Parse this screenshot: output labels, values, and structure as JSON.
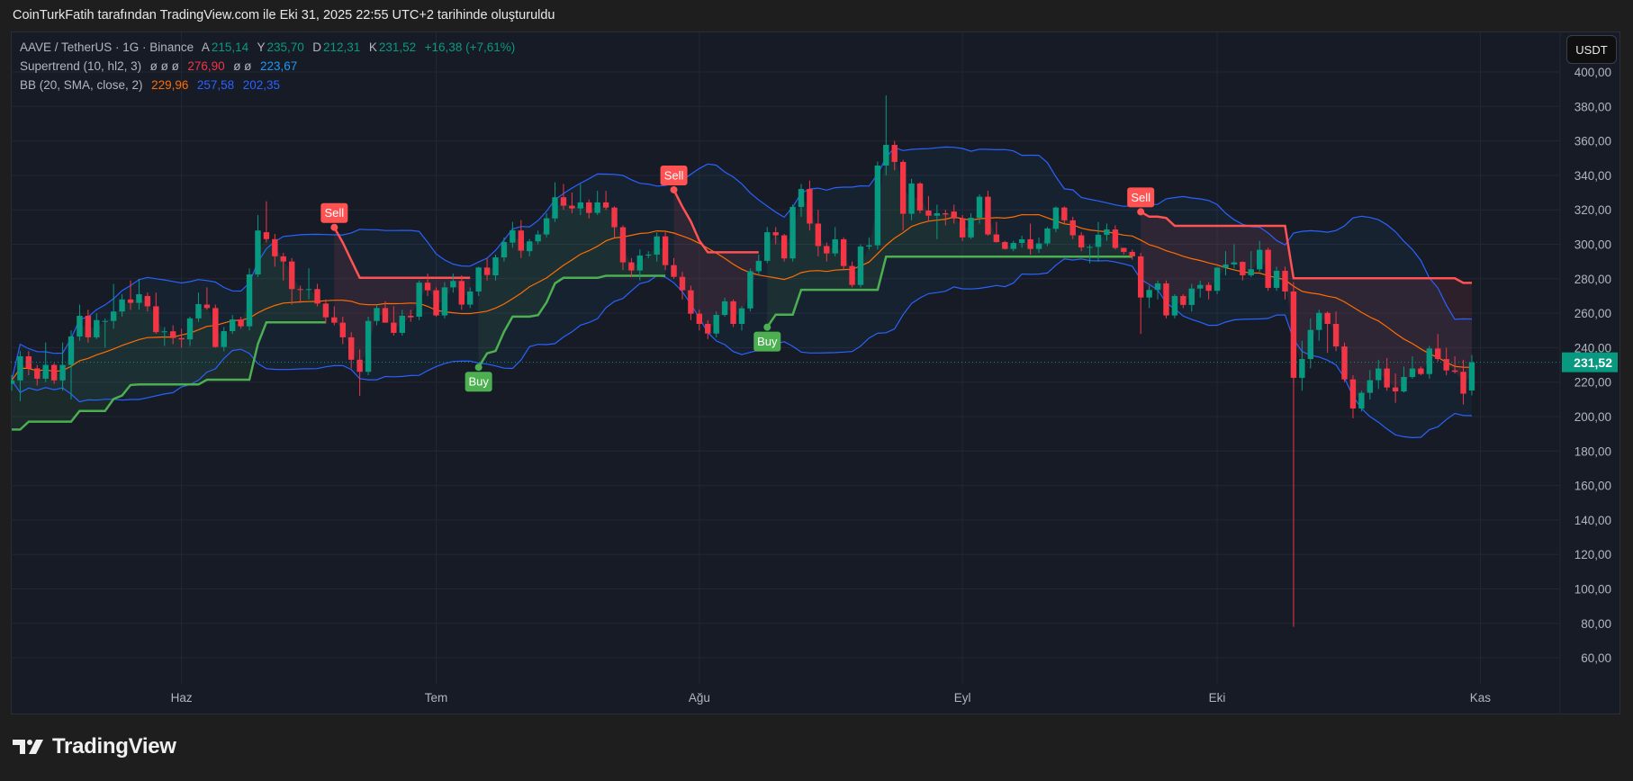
{
  "caption": "CoinTurkFatih tarafından TradingView.com ile Eki 31, 2025 22:55 UTC+2 tarihinde oluşturuldu",
  "legend": {
    "symbol": "AAVE / TetherUS · 1G · Binance",
    "o_label": "A",
    "o_value": "215,14",
    "h_label": "Y",
    "h_value": "235,70",
    "l_label": "D",
    "l_value": "212,31",
    "c_label": "K",
    "c_value": "231,52",
    "change": "+16,38 (+7,61%)",
    "supertrend_name": "Supertrend (10, hl2, 3)",
    "supertrend_na1": "ø  ø  ø",
    "supertrend_down": "276,90",
    "supertrend_na2": "ø  ø",
    "supertrend_body": "223,67",
    "bb_name": "BB (20, SMA, close, 2)",
    "bb_basis": "229,96",
    "bb_upper": "257,58",
    "bb_lower": "202,35"
  },
  "currency_button": "USDT",
  "last_price_label": "231,52",
  "brand": "TradingView",
  "colors": {
    "up": "#089981",
    "down": "#f23645",
    "st_up": "#4caf50",
    "st_down": "#ff5252",
    "bb_basis": "#ff6d00",
    "bb_band": "#2962ff"
  },
  "chart_data": {
    "type": "candlestick",
    "title": "AAVE / TetherUS · 1G · Binance",
    "ylabel": "USDT",
    "ylim": [
      60,
      400
    ],
    "y_ticks": [
      60,
      80,
      100,
      120,
      140,
      160,
      180,
      200,
      220,
      240,
      260,
      280,
      300,
      320,
      340,
      360,
      380,
      400
    ],
    "x_ticks": [
      {
        "label": "Haz",
        "index": 20
      },
      {
        "label": "Tem",
        "index": 50
      },
      {
        "label": "Ağu",
        "index": 81
      },
      {
        "label": "Eyl",
        "index": 112
      },
      {
        "label": "Eki",
        "index": 142
      },
      {
        "label": "Kas",
        "index": 173
      }
    ],
    "grid": true,
    "last_price": 231.52,
    "indicators": {
      "supertrend": {
        "atr_length": 10,
        "source": "hl2",
        "factor": 3,
        "buy_label": "Buy",
        "sell_label": "Sell"
      },
      "bollinger": {
        "length": 20,
        "type": "SMA",
        "source": "close",
        "mult": 2
      }
    },
    "ohlc": [
      [
        219,
        224,
        215,
        221
      ],
      [
        221,
        238,
        209,
        235
      ],
      [
        235,
        238,
        224,
        228
      ],
      [
        228,
        230,
        218,
        222
      ],
      [
        222,
        243,
        220,
        230
      ],
      [
        230,
        231,
        219,
        221
      ],
      [
        221,
        243,
        215,
        230
      ],
      [
        230,
        250,
        210,
        246.5
      ],
      [
        246.5,
        265,
        244,
        258.5
      ],
      [
        258.5,
        262,
        243,
        246
      ],
      [
        246,
        260,
        245,
        256
      ],
      [
        255,
        257,
        240,
        255.5
      ],
      [
        255.5,
        277,
        251,
        261
      ],
      [
        261,
        271,
        258,
        268
      ],
      [
        268,
        279,
        262,
        266
      ],
      [
        266,
        280,
        262,
        271
      ],
      [
        270,
        272,
        261,
        264
      ],
      [
        264,
        272,
        248,
        249
      ],
      [
        249.5,
        252,
        241,
        249.5
      ],
      [
        249.5,
        253,
        242,
        245.6
      ],
      [
        245.6,
        251,
        240,
        244.8
      ],
      [
        244.8,
        258,
        241,
        257
      ],
      [
        257,
        272,
        255,
        265.3
      ],
      [
        265,
        275,
        262,
        263
      ],
      [
        263,
        265,
        240,
        240.4
      ],
      [
        240.4,
        252,
        238,
        249.6
      ],
      [
        249.6,
        259,
        248,
        256.4
      ],
      [
        256.4,
        258,
        251,
        252.4
      ],
      [
        252.4,
        286,
        250,
        282.5
      ],
      [
        282.5,
        317,
        281,
        308
      ],
      [
        307,
        325,
        301,
        303
      ],
      [
        303,
        306,
        287,
        293
      ],
      [
        293,
        295,
        279,
        290
      ],
      [
        290,
        292,
        265,
        274
      ],
      [
        274,
        276,
        266,
        273.5
      ],
      [
        273.5,
        286,
        268,
        274
      ],
      [
        274,
        277,
        264,
        265.6
      ],
      [
        265.6,
        268,
        254,
        257.6
      ],
      [
        257.6,
        264,
        253,
        254.5
      ],
      [
        254.5,
        258,
        242,
        246
      ],
      [
        246,
        249,
        228,
        233
      ],
      [
        233,
        239,
        212,
        226
      ],
      [
        226,
        258,
        224,
        255.5
      ],
      [
        255.5,
        265,
        253,
        263
      ],
      [
        263,
        267,
        255,
        254.5
      ],
      [
        254.5,
        264,
        247,
        248.6
      ],
      [
        248.6,
        262,
        247,
        258.5
      ],
      [
        258.5,
        262,
        255,
        257.6
      ],
      [
        258,
        279,
        256,
        277.7
      ],
      [
        277.7,
        283,
        270,
        273.3
      ],
      [
        273.3,
        275,
        258,
        258.7
      ],
      [
        258.7,
        278,
        257,
        275
      ],
      [
        275,
        283,
        272,
        278.7
      ],
      [
        278.7,
        282,
        262,
        265
      ],
      [
        265,
        275,
        263,
        272.6
      ],
      [
        272.6,
        287,
        270,
        286.5
      ],
      [
        286.5,
        292,
        279,
        282.2
      ],
      [
        282,
        294,
        279,
        292.4
      ],
      [
        292.4,
        304,
        290,
        301.3
      ],
      [
        301,
        313,
        298,
        308.1
      ],
      [
        308,
        314,
        292,
        296.3
      ],
      [
        296,
        303,
        293,
        301.7
      ],
      [
        301.7,
        308,
        300,
        305.7
      ],
      [
        305.7,
        318,
        304,
        315.1
      ],
      [
        315,
        336,
        313,
        327.3
      ],
      [
        327.3,
        335,
        320,
        322.4
      ],
      [
        322.4,
        330,
        318,
        320.8
      ],
      [
        320.8,
        335,
        317,
        324.3
      ],
      [
        324.3,
        326,
        315,
        318.2
      ],
      [
        318.2,
        331,
        317,
        324.3
      ],
      [
        324.3,
        331,
        320,
        321.3
      ],
      [
        321.3,
        322,
        304,
        309.9
      ],
      [
        309.9,
        311,
        285,
        289.5
      ],
      [
        289.5,
        292,
        281,
        284.8
      ],
      [
        284.8,
        297,
        279,
        293.5
      ],
      [
        293.5,
        296,
        292,
        294
      ],
      [
        294,
        307,
        290,
        304.6
      ],
      [
        304.6,
        307,
        285,
        287.9
      ],
      [
        287.9,
        292,
        280,
        281.1
      ],
      [
        281.1,
        284,
        268,
        273.3
      ],
      [
        273.3,
        276,
        256,
        259.7
      ],
      [
        259.7,
        262,
        250,
        253.8
      ],
      [
        253.8,
        256,
        245,
        248.2
      ],
      [
        248.2,
        261,
        246,
        259
      ],
      [
        259,
        269,
        258,
        266.9
      ],
      [
        266.9,
        268,
        252,
        253.8
      ],
      [
        253.8,
        264,
        250,
        262.8
      ],
      [
        262.8,
        286,
        261,
        284.4
      ],
      [
        284.4,
        294,
        282,
        290.4
      ],
      [
        290.4,
        310,
        289,
        307
      ],
      [
        307,
        310,
        300,
        305.2
      ],
      [
        305.2,
        306,
        290,
        291.8
      ],
      [
        291.8,
        323,
        290,
        321.7
      ],
      [
        321.7,
        335,
        316,
        332.1
      ],
      [
        332.1,
        337,
        308,
        312
      ],
      [
        312,
        320,
        293,
        299
      ],
      [
        299,
        301,
        290,
        294.7
      ],
      [
        294.7,
        310,
        293,
        302.9
      ],
      [
        302.9,
        304,
        285,
        287.4
      ],
      [
        287.4,
        290,
        275,
        276.4
      ],
      [
        276.4,
        300,
        275,
        298.7
      ],
      [
        298.7,
        304,
        297,
        299.4
      ],
      [
        299.4,
        348,
        297,
        345.7
      ],
      [
        345.7,
        386.4,
        340,
        357.7
      ],
      [
        357.7,
        360,
        343,
        347.8
      ],
      [
        347.8,
        349,
        308,
        317.7
      ],
      [
        317.7,
        338,
        314,
        335.3
      ],
      [
        335.3,
        336,
        318,
        319.6
      ],
      [
        319.6,
        328,
        313,
        316.6
      ],
      [
        316.6,
        323,
        303,
        318
      ],
      [
        318,
        320,
        311,
        317.3
      ],
      [
        319,
        323,
        312,
        315
      ],
      [
        315,
        317,
        302,
        304
      ],
      [
        304,
        318,
        303,
        315.4
      ],
      [
        315.4,
        329,
        312,
        327.6
      ],
      [
        327.6,
        331,
        305,
        305.7
      ],
      [
        305.7,
        313,
        301,
        301.3
      ],
      [
        301.3,
        302,
        297,
        297.3
      ],
      [
        297.3,
        302,
        296,
        300.8
      ],
      [
        300.8,
        305,
        298,
        302.9
      ],
      [
        302.9,
        312,
        294,
        297.3
      ],
      [
        297.3,
        304,
        295,
        300.5
      ],
      [
        300.5,
        310,
        299,
        309.2
      ],
      [
        309,
        322,
        307,
        321.3
      ],
      [
        321.3,
        322,
        312,
        313.9
      ],
      [
        313.9,
        316,
        303,
        305.2
      ],
      [
        305.2,
        307,
        296,
        298.2
      ],
      [
        298.2,
        300,
        289,
        298.5
      ],
      [
        298.5,
        313,
        290,
        305.5
      ],
      [
        305.5,
        312,
        302,
        308.6
      ],
      [
        308.6,
        311,
        297,
        297.9
      ],
      [
        297.9,
        298,
        294,
        295.6
      ],
      [
        295.6,
        297,
        291,
        293
      ],
      [
        293,
        295,
        248,
        269.1
      ],
      [
        269.1,
        276,
        263,
        273.5
      ],
      [
        273.5,
        279,
        268,
        277.3
      ],
      [
        277.3,
        279,
        257,
        258.7
      ],
      [
        258.7,
        271,
        257,
        270
      ],
      [
        270,
        271,
        263,
        264.8
      ],
      [
        264.8,
        277,
        261,
        274.3
      ],
      [
        274.3,
        279,
        269,
        276.4
      ],
      [
        276.4,
        278,
        268,
        273
      ],
      [
        273,
        287,
        271,
        286.4
      ],
      [
        286.4,
        296,
        282,
        288.3
      ],
      [
        288.3,
        300,
        286,
        289.5
      ],
      [
        289.8,
        290,
        279,
        282
      ],
      [
        282,
        296,
        281,
        285.5
      ],
      [
        285.5,
        302,
        284,
        296.8
      ],
      [
        296.8,
        298,
        273,
        274.7
      ],
      [
        274.7,
        287,
        273,
        284.6
      ],
      [
        284.6,
        287,
        268,
        272.6
      ],
      [
        272.6,
        278,
        78,
        222.5
      ],
      [
        222.5,
        244,
        215,
        233.4
      ],
      [
        233.4,
        257,
        228,
        250.3
      ],
      [
        250.3,
        262,
        244,
        260.2
      ],
      [
        260.2,
        261,
        237,
        253.8
      ],
      [
        253.8,
        261,
        238,
        240.7
      ],
      [
        240.7,
        243,
        220,
        221.6
      ],
      [
        221.6,
        224,
        199,
        204.7
      ],
      [
        204.7,
        215,
        203,
        213.8
      ],
      [
        213.8,
        227,
        210,
        221.1
      ],
      [
        221.1,
        233,
        216,
        227.9
      ],
      [
        227.9,
        234,
        215,
        216.9
      ],
      [
        216.9,
        225,
        208,
        214.6
      ],
      [
        214.6,
        229,
        214,
        223
      ],
      [
        223,
        235,
        222,
        227.9
      ],
      [
        227.9,
        229,
        224,
        224.7
      ],
      [
        224.7,
        241,
        222,
        239.5
      ],
      [
        239.5,
        248,
        232,
        233.4
      ],
      [
        233.4,
        240,
        224,
        226.8
      ],
      [
        226.8,
        235,
        225,
        226
      ],
      [
        226,
        233,
        207,
        213.3
      ],
      [
        215.14,
        235.7,
        212.31,
        231.52
      ]
    ]
  }
}
